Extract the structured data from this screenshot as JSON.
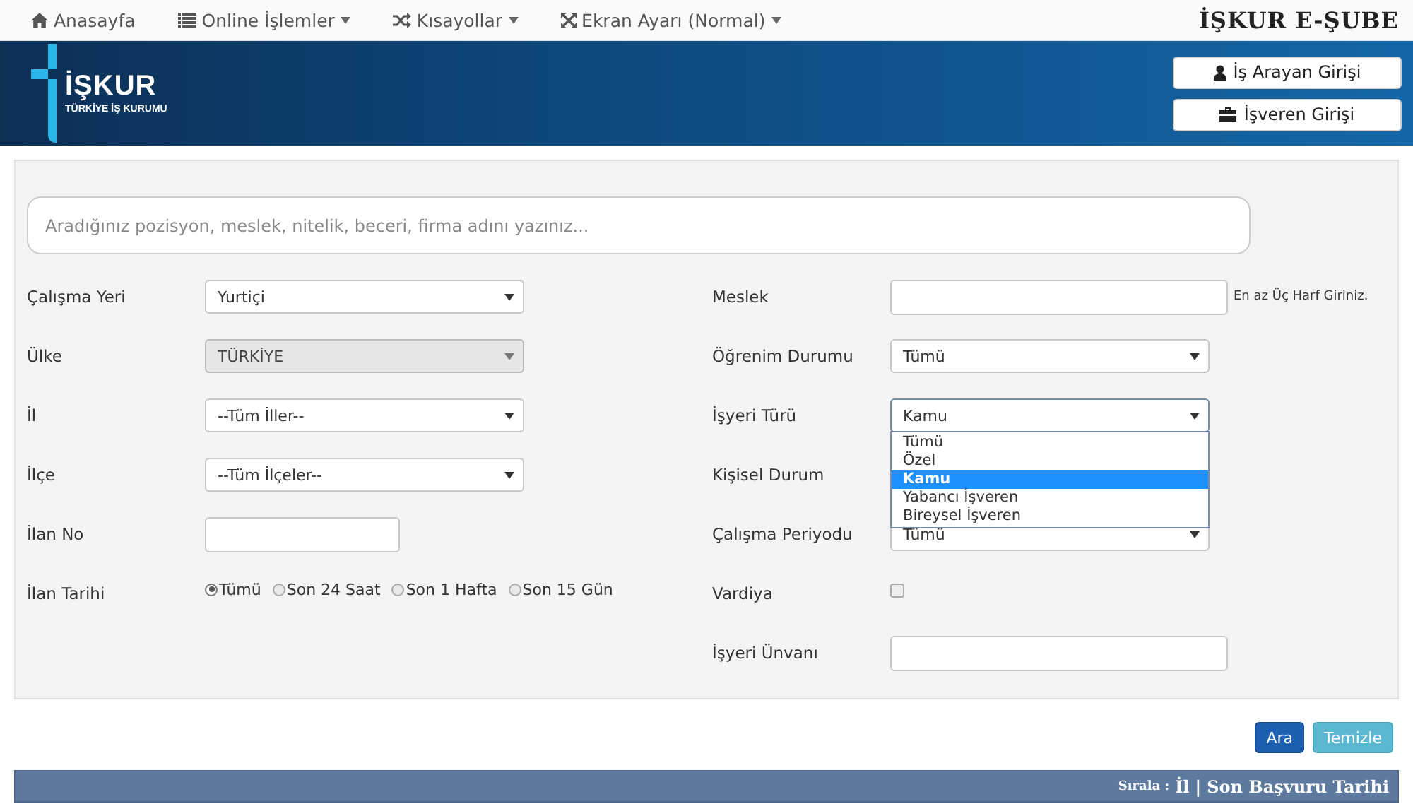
{
  "nav": {
    "items": [
      {
        "label": "Anasayfa",
        "has_menu": false
      },
      {
        "label": "Online İşlemler",
        "has_menu": true
      },
      {
        "label": "Kısayollar",
        "has_menu": true
      },
      {
        "label": "Ekran Ayarı (Normal)",
        "has_menu": true
      }
    ],
    "title": "İŞKUR E-ŞUBE"
  },
  "banner": {
    "logo_name": "İŞKUR",
    "logo_subtitle": "TÜRKİYE İŞ KURUMU",
    "buttons": [
      {
        "label": "İş Arayan Girişi"
      },
      {
        "label": "İşveren Girişi"
      }
    ]
  },
  "search": {
    "placeholder": "Aradığınız pozisyon, meslek, nitelik, beceri, firma adını yazınız..."
  },
  "left_fields": [
    {
      "label": "Çalışma Yeri",
      "kind": "select",
      "value": "Yurtiçi",
      "disabled": false
    },
    {
      "label": "Ülke",
      "kind": "select",
      "value": "TÜRKİYE",
      "disabled": true
    },
    {
      "label": "İl",
      "kind": "select",
      "value": "--Tüm İller--",
      "disabled": false
    },
    {
      "label": "İlçe",
      "kind": "select",
      "value": "--Tüm İlçeler--",
      "disabled": false
    },
    {
      "label": "İlan No",
      "kind": "input"
    },
    {
      "label": "İlan Tarihi",
      "kind": "radios",
      "options": [
        {
          "label": "Tümü",
          "selected": true
        },
        {
          "label": "Son 24 Saat",
          "selected": false
        },
        {
          "label": "Son 1 Hafta",
          "selected": false
        },
        {
          "label": "Son 15 Gün",
          "selected": false
        }
      ]
    }
  ],
  "right_fields": [
    {
      "label": "Meslek",
      "kind": "input",
      "hint": "En az Üç Harf Giriniz."
    },
    {
      "label": "Öğrenim Durumu",
      "kind": "select",
      "value": "Tümü",
      "disabled": false
    },
    {
      "label": "İşyeri Türü",
      "kind": "select",
      "value": "Kamu",
      "disabled": false,
      "expanded": true,
      "options": [
        {
          "label": "Tümü",
          "selected": false
        },
        {
          "label": "Özel",
          "selected": false
        },
        {
          "label": "Kamu",
          "selected": true
        },
        {
          "label": "Yabancı İşveren",
          "selected": false
        },
        {
          "label": "Bireysel İşveren",
          "selected": false
        }
      ]
    },
    {
      "label": "Kişisel Durum",
      "kind": "covered"
    },
    {
      "label": "Çalışma Periyodu",
      "kind": "select",
      "value": "Tümü",
      "disabled": false
    },
    {
      "label": "Vardiya",
      "kind": "checkbox",
      "checked": false
    },
    {
      "label": "İşyeri Ünvanı",
      "kind": "input"
    }
  ],
  "actions": [
    {
      "label": "Ara",
      "kind": "primary"
    },
    {
      "label": "Temizle",
      "kind": "secondary"
    }
  ],
  "sort_bar": {
    "label": "Sırala :",
    "options": [
      {
        "label": "İl"
      },
      {
        "label": "Son Başvuru Tarihi"
      }
    ],
    "separator": "|"
  }
}
